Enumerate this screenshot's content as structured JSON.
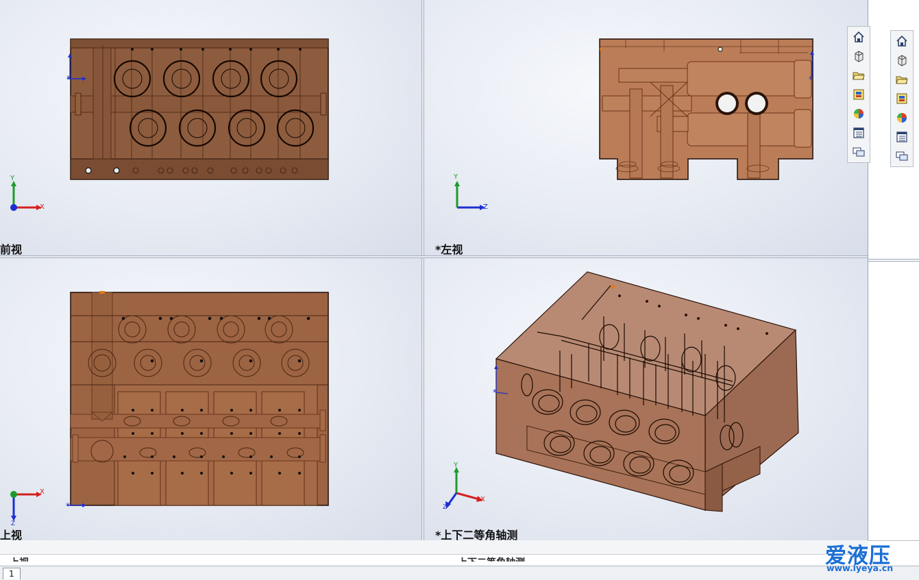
{
  "views": {
    "front_label": "前视",
    "left_label": "*左视",
    "top_label": "上视",
    "iso_label": "*上下二等角轴测"
  },
  "triad": {
    "x": "X",
    "y": "Y",
    "z": "Z"
  },
  "toolbar": {
    "buttons": [
      "home-view",
      "view-orientation",
      "open-folder",
      "design-library",
      "appearances",
      "file-properties",
      "view-palette-messages"
    ]
  },
  "bottom": {
    "ghost_top_label": "上视",
    "ghost_iso_label": "上下二等角轴测",
    "tab_label": "1"
  },
  "watermark": {
    "brand": "爱液压",
    "url": "www.iyeya.cn"
  },
  "colors": {
    "body_fill": "#8b5a3c",
    "feature_stroke": "#2a1208",
    "axis_x": "#d42020",
    "axis_y": "#1d9b2a",
    "axis_z": "#1c2fd0",
    "watermark": "#1a6fd6"
  }
}
